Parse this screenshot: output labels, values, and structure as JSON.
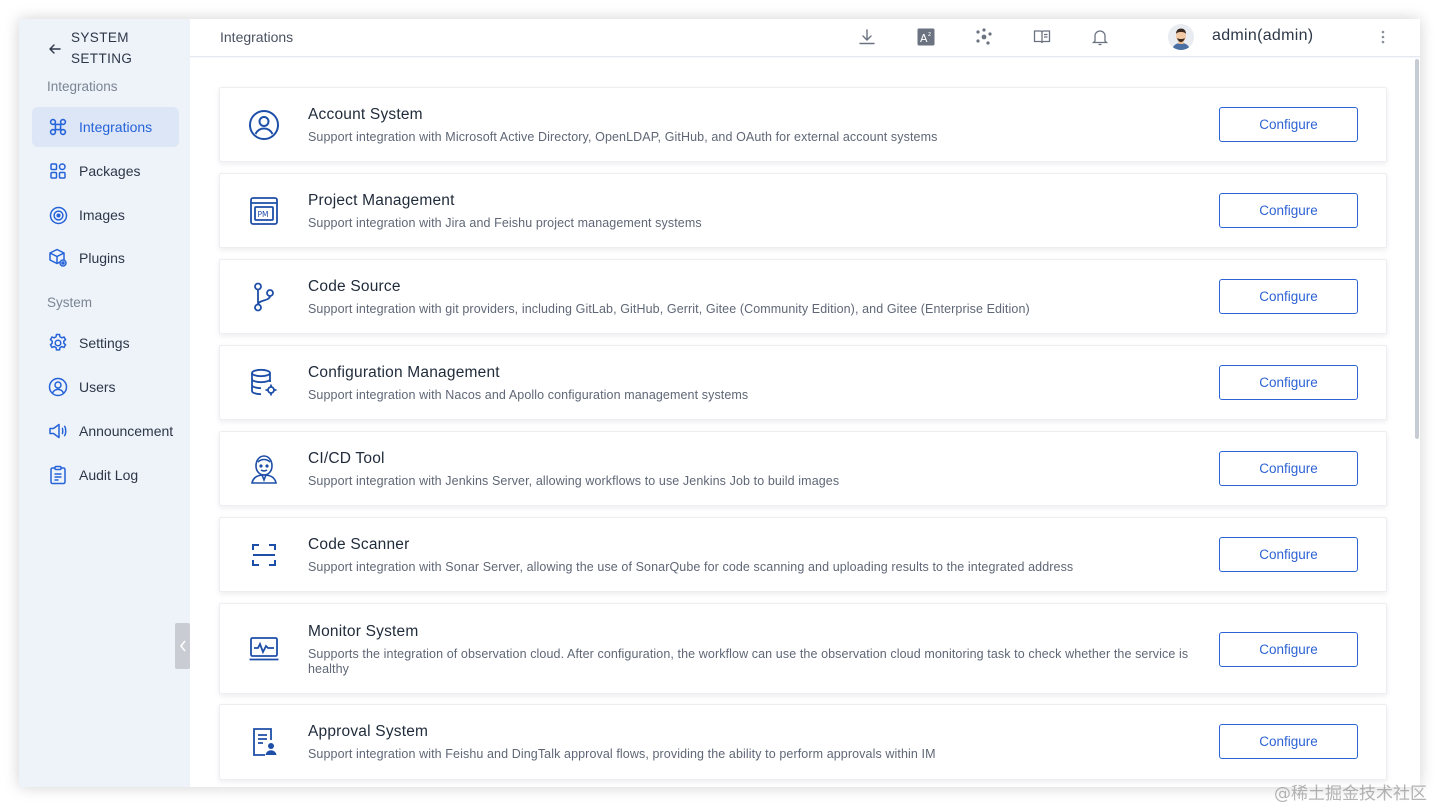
{
  "sidebar": {
    "back_title": "SYSTEM SETTING",
    "groups": [
      {
        "label": "Integrations",
        "items": [
          {
            "label": "Integrations",
            "icon": "integrations-icon",
            "active": true
          },
          {
            "label": "Packages",
            "icon": "packages-icon"
          },
          {
            "label": "Images",
            "icon": "images-icon"
          },
          {
            "label": "Plugins",
            "icon": "plugins-icon"
          }
        ]
      },
      {
        "label": "System",
        "items": [
          {
            "label": "Settings",
            "icon": "settings-icon"
          },
          {
            "label": "Users",
            "icon": "users-icon"
          },
          {
            "label": "Announcement",
            "icon": "announcement-icon"
          },
          {
            "label": "Audit Log",
            "icon": "audit-log-icon"
          }
        ]
      }
    ]
  },
  "topbar": {
    "breadcrumb": "Integrations",
    "icons": [
      "download-icon",
      "translate-icon",
      "apps-icon",
      "docs-icon",
      "bell-icon"
    ],
    "username": "admin(admin)"
  },
  "integrations": [
    {
      "title": "Account System",
      "description": "Support integration with Microsoft Active Directory, OpenLDAP, GitHub, and OAuth for external account systems",
      "button": "Configure",
      "icon": "account-system-icon"
    },
    {
      "title": "Project Management",
      "description": "Support integration with Jira and Feishu project management systems",
      "button": "Configure",
      "icon": "project-management-icon"
    },
    {
      "title": "Code Source",
      "description": "Support integration with git providers, including GitLab, GitHub, Gerrit, Gitee (Community Edition), and Gitee (Enterprise Edition)",
      "button": "Configure",
      "icon": "code-source-icon"
    },
    {
      "title": "Configuration Management",
      "description": "Support integration with Nacos and Apollo configuration management systems",
      "button": "Configure",
      "icon": "configuration-management-icon"
    },
    {
      "title": "CI/CD Tool",
      "description": "Support integration with Jenkins Server, allowing workflows to use Jenkins Job to build images",
      "button": "Configure",
      "icon": "jenkins-icon"
    },
    {
      "title": "Code Scanner",
      "description": "Support integration with Sonar Server, allowing the use of SonarQube for code scanning and uploading results to the integrated address",
      "button": "Configure",
      "icon": "code-scanner-icon"
    },
    {
      "title": "Monitor System",
      "description": "Supports the integration of observation cloud. After configuration, the workflow can use the observation cloud monitoring task to check whether the service is healthy",
      "button": "Configure",
      "icon": "monitor-system-icon"
    },
    {
      "title": "Approval System",
      "description": "Support integration with Feishu and DingTalk approval flows, providing the ability to perform approvals within IM",
      "button": "Configure",
      "icon": "approval-system-icon"
    }
  ],
  "colors": {
    "accent": "#2563d9",
    "active_nav_bg": "#dde6f6",
    "sidebar_bg": "#eef2f9",
    "button_border": "#2d63d4"
  },
  "watermark": "@稀土掘金技术社区"
}
